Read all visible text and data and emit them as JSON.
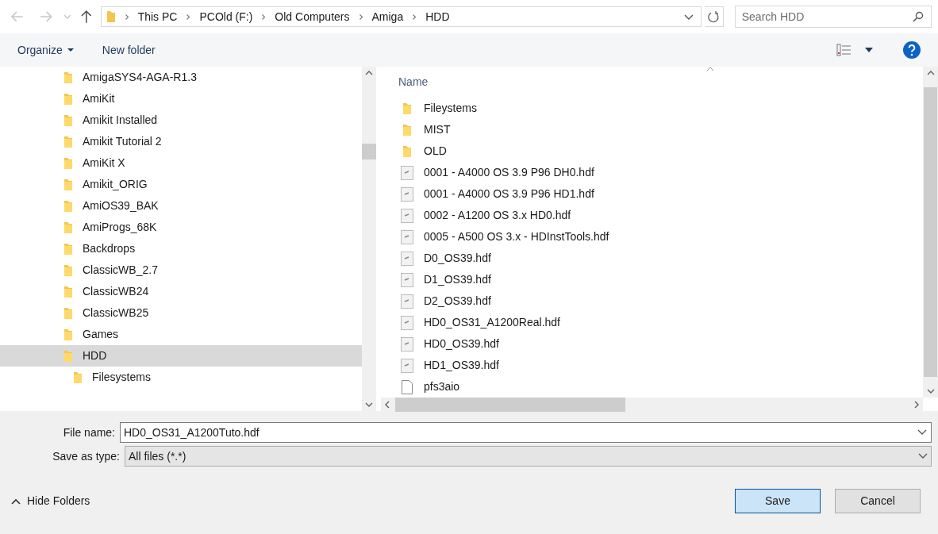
{
  "address_bar": {
    "crumbs": [
      "This PC",
      "PCOld (F:)",
      "Old Computers",
      "Amiga",
      "HDD"
    ]
  },
  "search": {
    "placeholder": "Search HDD"
  },
  "toolbar": {
    "organize": "Organize",
    "new_folder": "New folder"
  },
  "sidebar": {
    "items": [
      {
        "label": "AmigaSYS4-AGA-R1.3",
        "selected": false
      },
      {
        "label": "AmiKit",
        "selected": false
      },
      {
        "label": "Amikit Installed",
        "selected": false
      },
      {
        "label": "Amikit Tutorial 2",
        "selected": false
      },
      {
        "label": "AmiKit X",
        "selected": false
      },
      {
        "label": "Amikit_ORIG",
        "selected": false
      },
      {
        "label": "AmiOS39_BAK",
        "selected": false
      },
      {
        "label": "AmiProgs_68K",
        "selected": false
      },
      {
        "label": "Backdrops",
        "selected": false
      },
      {
        "label": "ClassicWB_2.7",
        "selected": false
      },
      {
        "label": "ClassicWB24",
        "selected": false
      },
      {
        "label": "ClassicWB25",
        "selected": false
      },
      {
        "label": "Games",
        "selected": false
      },
      {
        "label": "HDD",
        "selected": true,
        "children": [
          {
            "label": "Filesystems",
            "selected": false
          }
        ]
      }
    ]
  },
  "file_list": {
    "column": "Name",
    "items": [
      {
        "name": "Fileystems",
        "kind": "folder"
      },
      {
        "name": "MIST",
        "kind": "folder"
      },
      {
        "name": "OLD",
        "kind": "folder"
      },
      {
        "name": "0001 - A4000 OS 3.9 P96 DH0.hdf",
        "kind": "disk"
      },
      {
        "name": "0001 - A4000 OS 3.9 P96 HD1.hdf",
        "kind": "disk"
      },
      {
        "name": "0002 - A1200 OS 3.x HD0.hdf",
        "kind": "disk"
      },
      {
        "name": "0005 - A500 OS 3.x - HDInstTools.hdf",
        "kind": "disk"
      },
      {
        "name": "D0_OS39.hdf",
        "kind": "disk"
      },
      {
        "name": "D1_OS39.hdf",
        "kind": "disk"
      },
      {
        "name": "D2_OS39.hdf",
        "kind": "disk"
      },
      {
        "name": "HD0_OS31_A1200Real.hdf",
        "kind": "disk"
      },
      {
        "name": "HD0_OS39.hdf",
        "kind": "disk"
      },
      {
        "name": "HD1_OS39.hdf",
        "kind": "disk"
      },
      {
        "name": "pfs3aio",
        "kind": "file"
      }
    ]
  },
  "file_name": {
    "label": "File name:",
    "value": "HD0_OS31_A1200Tuto.hdf"
  },
  "save_type": {
    "label": "Save as type:",
    "value": "All files (*.*)"
  },
  "hide_folders": "Hide Folders",
  "buttons": {
    "save": "Save",
    "cancel": "Cancel"
  }
}
